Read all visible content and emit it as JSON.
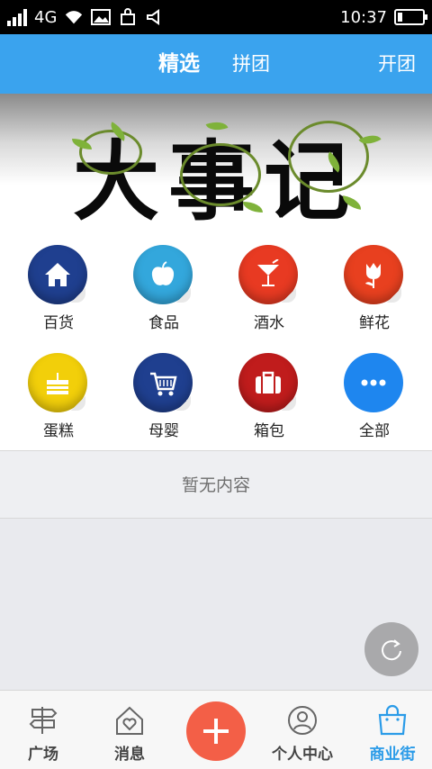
{
  "status_bar": {
    "network": "4G",
    "time": "10:37",
    "battery_level": 0.2,
    "icons": [
      "signal-icon",
      "wifi-icon",
      "image-icon",
      "bag-icon",
      "volume-icon",
      "battery-icon"
    ]
  },
  "header": {
    "tabs": [
      {
        "label": "精选",
        "active": true
      },
      {
        "label": "拼团",
        "active": false
      }
    ],
    "action_label": "开团",
    "background_color": "#3aa3ee"
  },
  "banner": {
    "title": "大事记"
  },
  "categories": [
    {
      "label": "百货",
      "icon": "house-icon",
      "color": "#1f3f8f"
    },
    {
      "label": "食品",
      "icon": "apple-icon",
      "color": "#33a7dc"
    },
    {
      "label": "酒水",
      "icon": "cocktail-icon",
      "color": "#e83a22"
    },
    {
      "label": "鲜花",
      "icon": "tulip-icon",
      "color": "#e8401f"
    },
    {
      "label": "蛋糕",
      "icon": "cake-icon",
      "color": "#f2cf0a"
    },
    {
      "label": "母婴",
      "icon": "cart-icon",
      "color": "#1f3f8f"
    },
    {
      "label": "箱包",
      "icon": "suitcase-icon",
      "color": "#c01c1c"
    },
    {
      "label": "全部",
      "icon": "more-icon",
      "color": "#1e86ef"
    }
  ],
  "empty_state": {
    "text": "暂无内容"
  },
  "bottom_nav": {
    "items": [
      {
        "label": "广场",
        "icon": "signpost-icon"
      },
      {
        "label": "消息",
        "icon": "home-heart-icon"
      },
      {
        "label": "个人中心",
        "icon": "person-icon"
      },
      {
        "label": "商业街",
        "icon": "shopping-bag-icon"
      }
    ],
    "active": "商业街",
    "center_button_icon": "plus-icon",
    "accent_color": "#2a9be8",
    "center_button_color": "#f35f47"
  }
}
